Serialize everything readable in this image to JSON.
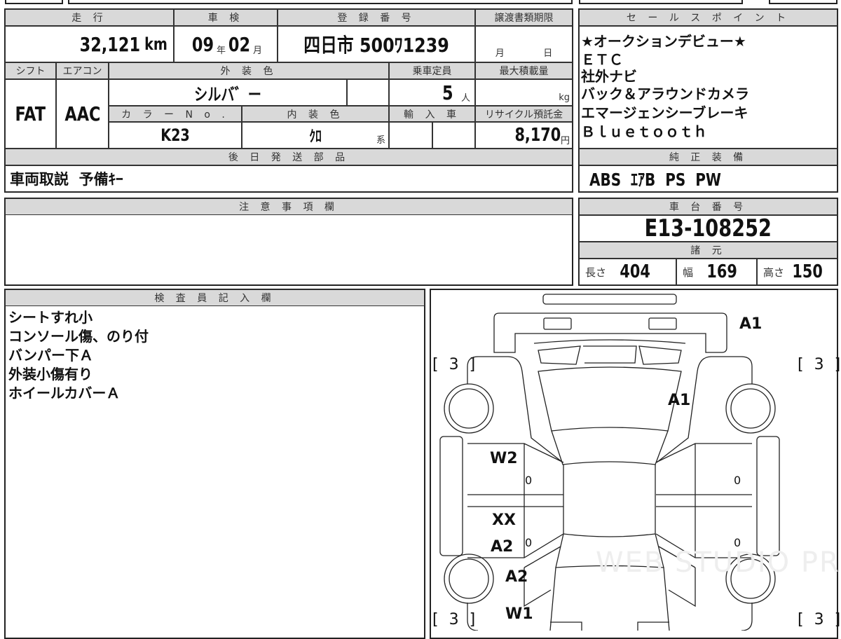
{
  "top_table": {
    "headers": {
      "mileage": "走 行",
      "inspection": "車 検",
      "registration": "登 録 番 号",
      "transfer_deadline": "譲渡書類期限"
    },
    "mileage": "32,121",
    "mileage_unit": "km",
    "inspection_year": "09",
    "year_unit": "年",
    "inspection_month": "02",
    "month_unit": "月",
    "registration": "四日市 500ﾜ1239",
    "deadline_month": "月",
    "deadline_day": "日",
    "headers2": {
      "shift": "シフト",
      "aircon": "エアコン",
      "exterior_color": "外 装 色",
      "capacity": "乗車定員",
      "max_load": "最大積載量"
    },
    "shift": "FAT",
    "aircon": "AAC",
    "exterior_color": "シルバ゛ー",
    "capacity": "5",
    "capacity_unit": "人",
    "max_load_unit": "kg",
    "headers3": {
      "color_no": "カ ラ ー N o .",
      "interior_color": "内 装 色",
      "imported": "輸 入 車",
      "recycle_fee": "リサイクル預託金"
    },
    "color_no": "K23",
    "interior_color": "ｸﾛ",
    "interior_suffix": "系",
    "recycle_fee": "8,170",
    "recycle_unit": "円",
    "later_parts_header": "後 日 発 送 部 品",
    "later_parts": "車両取説  予備ｷｰ"
  },
  "sales_points": {
    "header": "セ ー ル ス ポ イ ン ト",
    "items": [
      "★オークションデビュー★",
      "ＥＴＣ",
      "社外ナビ",
      "バック＆アラウンドカメラ",
      "エマージェンシーブレーキ",
      "Ｂｌｕｅｔｏｏｔｈ"
    ]
  },
  "genuine_equipment": {
    "header": "純 正 装 備",
    "value": "ABS  ｴｱB  PS  PW"
  },
  "notes": {
    "header": "注 意 事 項 欄"
  },
  "chassis": {
    "header": "車 台 番 号",
    "value": "E13-108252",
    "spec_header": "諸 元",
    "length_label": "長さ",
    "length": "404",
    "width_label": "幅",
    "width": "169",
    "height_label": "高さ",
    "height": "150"
  },
  "inspector": {
    "header": "検 査 員 記 入 欄",
    "items": [
      "シートすれ小",
      "コンソール傷、のり付",
      "バンパー下Ａ",
      "外装小傷有り",
      "ホイールカバーＡ"
    ]
  },
  "diagram": {
    "labels": {
      "rear_bumper": "A1",
      "rear_window": "A1",
      "tire_rl": "[ 3 ]",
      "tire_rr": "[ 3 ]",
      "tire_fl": "[ 3 ]",
      "tire_fr": "[ 3 ]",
      "left_rear_door": "W2",
      "left_rear_door_mark": "0",
      "right_rear_door_mark": "0",
      "left_front_door_1": "XX",
      "left_front_door_2": "A2",
      "left_front_door_mark": "0",
      "right_front_door_mark": "0",
      "left_front_fender": "A2",
      "left_front_bumper": "W1"
    },
    "watermark": "WEB STUDIO PRO"
  }
}
